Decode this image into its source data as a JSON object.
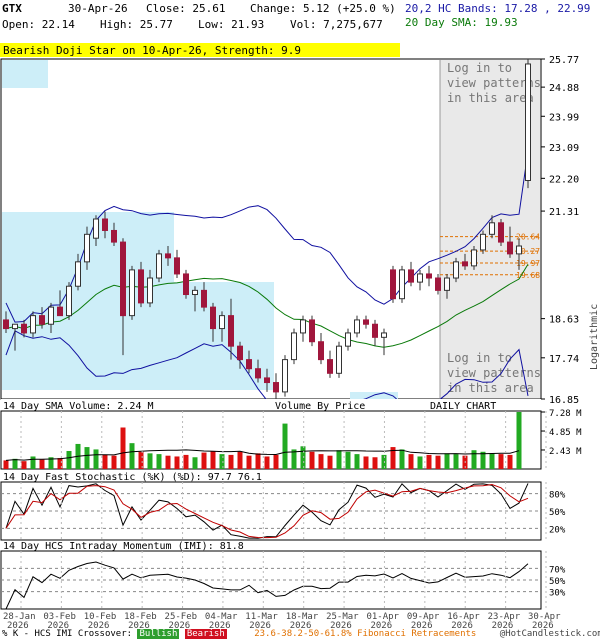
{
  "header": {
    "symbol": "GTX",
    "date": "30-Apr-26",
    "close": "Close: 25.61",
    "change": "Change: 5.12 (+25.0 %)",
    "open": "Open: 22.14",
    "high": "High: 25.77",
    "low": "Low: 21.93",
    "volume": "Vol: 7,275,677",
    "bands": "20,2 HC Bands: 17.28 , 22.99",
    "sma": "20 Day SMA: 19.93"
  },
  "pattern_banner": "Bearish Doji Star on 10-Apr-26, Strength: 9.9",
  "login_top": [
    "Log in to",
    "view patterns",
    "in this area"
  ],
  "login_bottom": [
    "Log in to",
    "view patterns",
    "in this area"
  ],
  "y_axis_title": "Logarithmic",
  "panels": {
    "volume_title": "14 Day SMA Volume: 2.24 M",
    "volume_by_price": "Volume By Price",
    "daily_chart": "DAILY CHART",
    "stoch_title": "14 Day Fast Stochastic (%K) (%D): 97.7  76.1",
    "imi_title": "14 Day HCS Intraday Momentum (IMI): 81.8"
  },
  "footer": {
    "crossover": "% K - HCS IMI Crossover:",
    "bullish": "Bullish",
    "bearish": "Bearish",
    "fib": "23.6-38.2-50-61.8% Fibonacci Retracements",
    "copyright": "@HotCandlestick.com"
  },
  "colors": {
    "bull": "#2e9e2e",
    "bear": "#a0163c",
    "band": "#1010a0",
    "sma": "#0a7a0a",
    "highlight": "#cdeef8",
    "fib": "#e07000",
    "banner": "#ffff00"
  },
  "chart_data": {
    "type": "candlestick",
    "scale": "log",
    "price_ticks": [
      25.77,
      24.88,
      23.99,
      23.09,
      22.2,
      21.31,
      18.63,
      17.74,
      16.85
    ],
    "fib_levels": [
      20.64,
      20.27,
      19.97,
      19.68
    ],
    "volume_ticks": [
      "7.28 M",
      "4.85 M",
      "2.43 M"
    ],
    "stoch_ticks": [
      "80%",
      "50%",
      "20%"
    ],
    "imi_ticks": [
      "70%",
      "50%",
      "30%"
    ],
    "x_labels": [
      [
        "28-Jan",
        "2026"
      ],
      [
        "03-Feb",
        "2026"
      ],
      [
        "10-Feb",
        "2026"
      ],
      [
        "18-Feb",
        "2026"
      ],
      [
        "25-Feb",
        "2026"
      ],
      [
        "04-Mar",
        "2026"
      ],
      [
        "11-Mar",
        "2026"
      ],
      [
        "18-Mar",
        "2026"
      ],
      [
        "25-Mar",
        "2026"
      ],
      [
        "01-Apr",
        "2026"
      ],
      [
        "09-Apr",
        "2026"
      ],
      [
        "16-Apr",
        "2026"
      ],
      [
        "23-Apr",
        "2026"
      ],
      [
        "30-Apr",
        "2026"
      ]
    ],
    "candles": [
      {
        "o": 18.6,
        "h": 18.8,
        "l": 18.3,
        "c": 18.4
      },
      {
        "o": 18.4,
        "h": 18.5,
        "l": 17.9,
        "c": 18.5
      },
      {
        "o": 18.5,
        "h": 18.6,
        "l": 18.2,
        "c": 18.3
      },
      {
        "o": 18.3,
        "h": 18.8,
        "l": 18.2,
        "c": 18.7
      },
      {
        "o": 18.7,
        "h": 18.9,
        "l": 18.4,
        "c": 18.5
      },
      {
        "o": 18.5,
        "h": 19.0,
        "l": 18.3,
        "c": 18.9
      },
      {
        "o": 18.9,
        "h": 19.3,
        "l": 18.8,
        "c": 18.7
      },
      {
        "o": 18.7,
        "h": 19.5,
        "l": 18.6,
        "c": 19.4
      },
      {
        "o": 19.4,
        "h": 20.2,
        "l": 19.3,
        "c": 20.0
      },
      {
        "o": 20.0,
        "h": 20.9,
        "l": 19.8,
        "c": 20.7
      },
      {
        "o": 20.6,
        "h": 21.2,
        "l": 20.4,
        "c": 21.1
      },
      {
        "o": 21.1,
        "h": 21.3,
        "l": 20.6,
        "c": 20.8
      },
      {
        "o": 20.8,
        "h": 21.0,
        "l": 20.4,
        "c": 20.5
      },
      {
        "o": 20.5,
        "h": 20.6,
        "l": 17.8,
        "c": 18.7
      },
      {
        "o": 18.7,
        "h": 19.9,
        "l": 18.6,
        "c": 19.8
      },
      {
        "o": 19.8,
        "h": 20.0,
        "l": 18.9,
        "c": 19.0
      },
      {
        "o": 19.0,
        "h": 19.8,
        "l": 18.9,
        "c": 19.6
      },
      {
        "o": 19.6,
        "h": 20.3,
        "l": 19.5,
        "c": 20.2
      },
      {
        "o": 20.2,
        "h": 20.4,
        "l": 19.9,
        "c": 20.1
      },
      {
        "o": 20.1,
        "h": 20.3,
        "l": 19.6,
        "c": 19.7
      },
      {
        "o": 19.7,
        "h": 19.8,
        "l": 19.1,
        "c": 19.2
      },
      {
        "o": 19.2,
        "h": 19.4,
        "l": 18.8,
        "c": 19.3
      },
      {
        "o": 19.3,
        "h": 19.5,
        "l": 18.8,
        "c": 18.9
      },
      {
        "o": 18.9,
        "h": 19.0,
        "l": 18.1,
        "c": 18.4
      },
      {
        "o": 18.4,
        "h": 18.8,
        "l": 18.1,
        "c": 18.7
      },
      {
        "o": 18.7,
        "h": 19.1,
        "l": 17.7,
        "c": 18.0
      },
      {
        "o": 18.0,
        "h": 18.1,
        "l": 17.5,
        "c": 17.7
      },
      {
        "o": 17.7,
        "h": 17.9,
        "l": 17.4,
        "c": 17.5
      },
      {
        "o": 17.5,
        "h": 17.7,
        "l": 17.2,
        "c": 17.3
      },
      {
        "o": 17.3,
        "h": 17.5,
        "l": 17.0,
        "c": 17.2
      },
      {
        "o": 17.2,
        "h": 17.4,
        "l": 16.8,
        "c": 17.0
      },
      {
        "o": 17.0,
        "h": 17.8,
        "l": 16.9,
        "c": 17.7
      },
      {
        "o": 17.7,
        "h": 18.4,
        "l": 17.6,
        "c": 18.3
      },
      {
        "o": 18.3,
        "h": 18.7,
        "l": 18.1,
        "c": 18.6
      },
      {
        "o": 18.6,
        "h": 18.7,
        "l": 18.0,
        "c": 18.1
      },
      {
        "o": 18.1,
        "h": 18.3,
        "l": 17.6,
        "c": 17.7
      },
      {
        "o": 17.7,
        "h": 17.9,
        "l": 17.3,
        "c": 17.4
      },
      {
        "o": 17.4,
        "h": 18.1,
        "l": 17.3,
        "c": 18.0
      },
      {
        "o": 18.0,
        "h": 18.4,
        "l": 17.9,
        "c": 18.3
      },
      {
        "o": 18.3,
        "h": 18.7,
        "l": 18.2,
        "c": 18.6
      },
      {
        "o": 18.6,
        "h": 18.7,
        "l": 18.4,
        "c": 18.5
      },
      {
        "o": 18.5,
        "h": 18.6,
        "l": 18.0,
        "c": 18.2
      },
      {
        "o": 18.2,
        "h": 18.4,
        "l": 17.8,
        "c": 18.3
      },
      {
        "o": 19.8,
        "h": 19.9,
        "l": 19.0,
        "c": 19.1
      },
      {
        "o": 19.1,
        "h": 19.9,
        "l": 19.0,
        "c": 19.8
      },
      {
        "o": 19.8,
        "h": 20.0,
        "l": 19.4,
        "c": 19.5
      },
      {
        "o": 19.5,
        "h": 19.8,
        "l": 19.3,
        "c": 19.7
      },
      {
        "o": 19.7,
        "h": 19.9,
        "l": 19.4,
        "c": 19.6
      },
      {
        "o": 19.6,
        "h": 19.7,
        "l": 19.2,
        "c": 19.3
      },
      {
        "o": 19.3,
        "h": 19.7,
        "l": 19.1,
        "c": 19.6
      },
      {
        "o": 19.6,
        "h": 20.1,
        "l": 19.5,
        "c": 20.0
      },
      {
        "o": 20.0,
        "h": 20.2,
        "l": 19.8,
        "c": 19.9
      },
      {
        "o": 19.9,
        "h": 20.4,
        "l": 19.8,
        "c": 20.3
      },
      {
        "o": 20.3,
        "h": 20.8,
        "l": 20.2,
        "c": 20.7
      },
      {
        "o": 20.7,
        "h": 21.2,
        "l": 20.6,
        "c": 21.0
      },
      {
        "o": 21.0,
        "h": 21.1,
        "l": 20.4,
        "c": 20.5
      },
      {
        "o": 20.5,
        "h": 20.9,
        "l": 20.1,
        "c": 20.2
      },
      {
        "o": 20.2,
        "h": 20.6,
        "l": 19.8,
        "c": 20.4
      },
      {
        "o": 22.14,
        "h": 25.77,
        "l": 21.93,
        "c": 25.61
      }
    ],
    "volume": [
      1.1,
      1.3,
      1.0,
      1.6,
      1.2,
      1.5,
      1.4,
      2.3,
      3.2,
      2.8,
      2.5,
      1.8,
      1.7,
      5.3,
      3.3,
      2.2,
      2.0,
      1.9,
      1.7,
      1.6,
      1.8,
      1.5,
      2.1,
      2.3,
      1.9,
      1.8,
      2.2,
      1.7,
      2.0,
      1.6,
      1.8,
      5.8,
      2.5,
      2.9,
      2.2,
      1.9,
      1.7,
      2.4,
      2.2,
      1.9,
      1.6,
      1.5,
      1.8,
      2.8,
      2.5,
      1.9,
      1.6,
      1.8,
      1.7,
      2.0,
      1.9,
      1.7,
      2.4,
      2.2,
      2.0,
      1.9,
      1.8,
      7.28
    ]
  }
}
